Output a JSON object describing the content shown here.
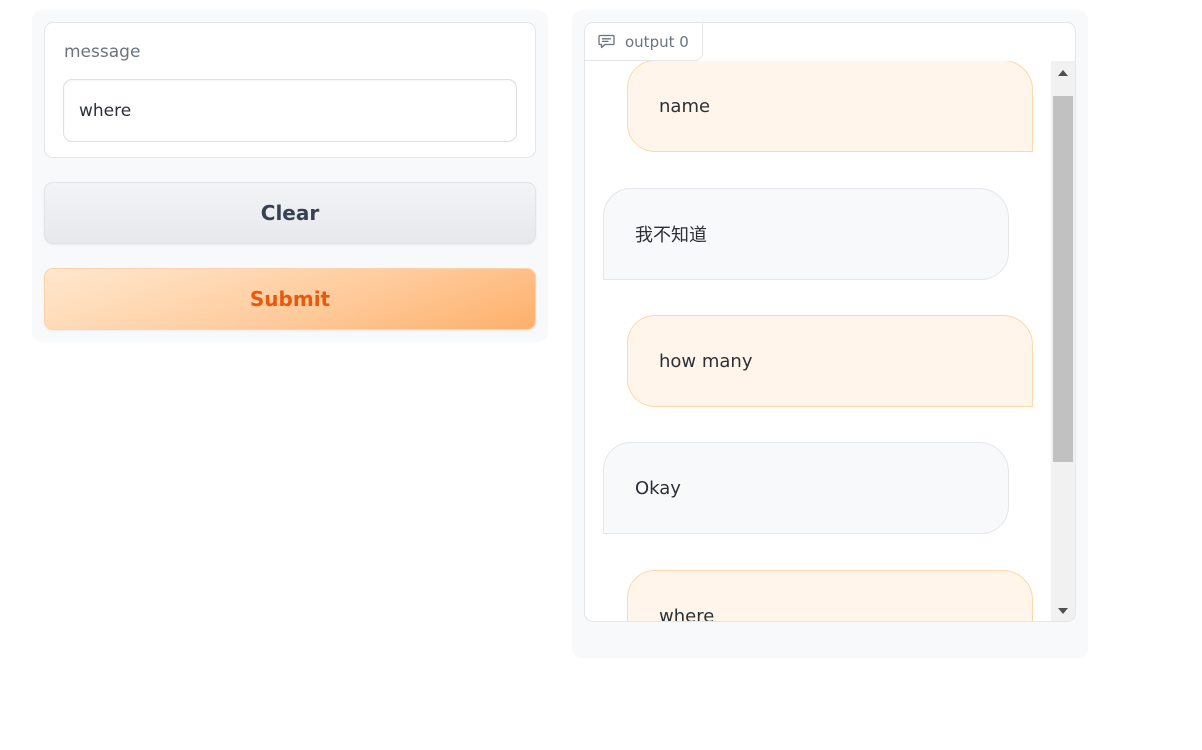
{
  "input": {
    "label": "message",
    "value": "where"
  },
  "buttons": {
    "clear_label": "Clear",
    "submit_label": "Submit"
  },
  "output": {
    "label": "output 0",
    "icon": "chat-icon",
    "messages": [
      {
        "role": "user",
        "text": "name"
      },
      {
        "role": "bot",
        "text": "我不知道"
      },
      {
        "role": "user",
        "text": "how many"
      },
      {
        "role": "bot",
        "text": "Okay"
      },
      {
        "role": "user",
        "text": "where"
      }
    ]
  },
  "colors": {
    "submit_text": "#ea580c",
    "user_bubble": "#fff5ea",
    "bot_bubble": "#f8f9fb"
  }
}
